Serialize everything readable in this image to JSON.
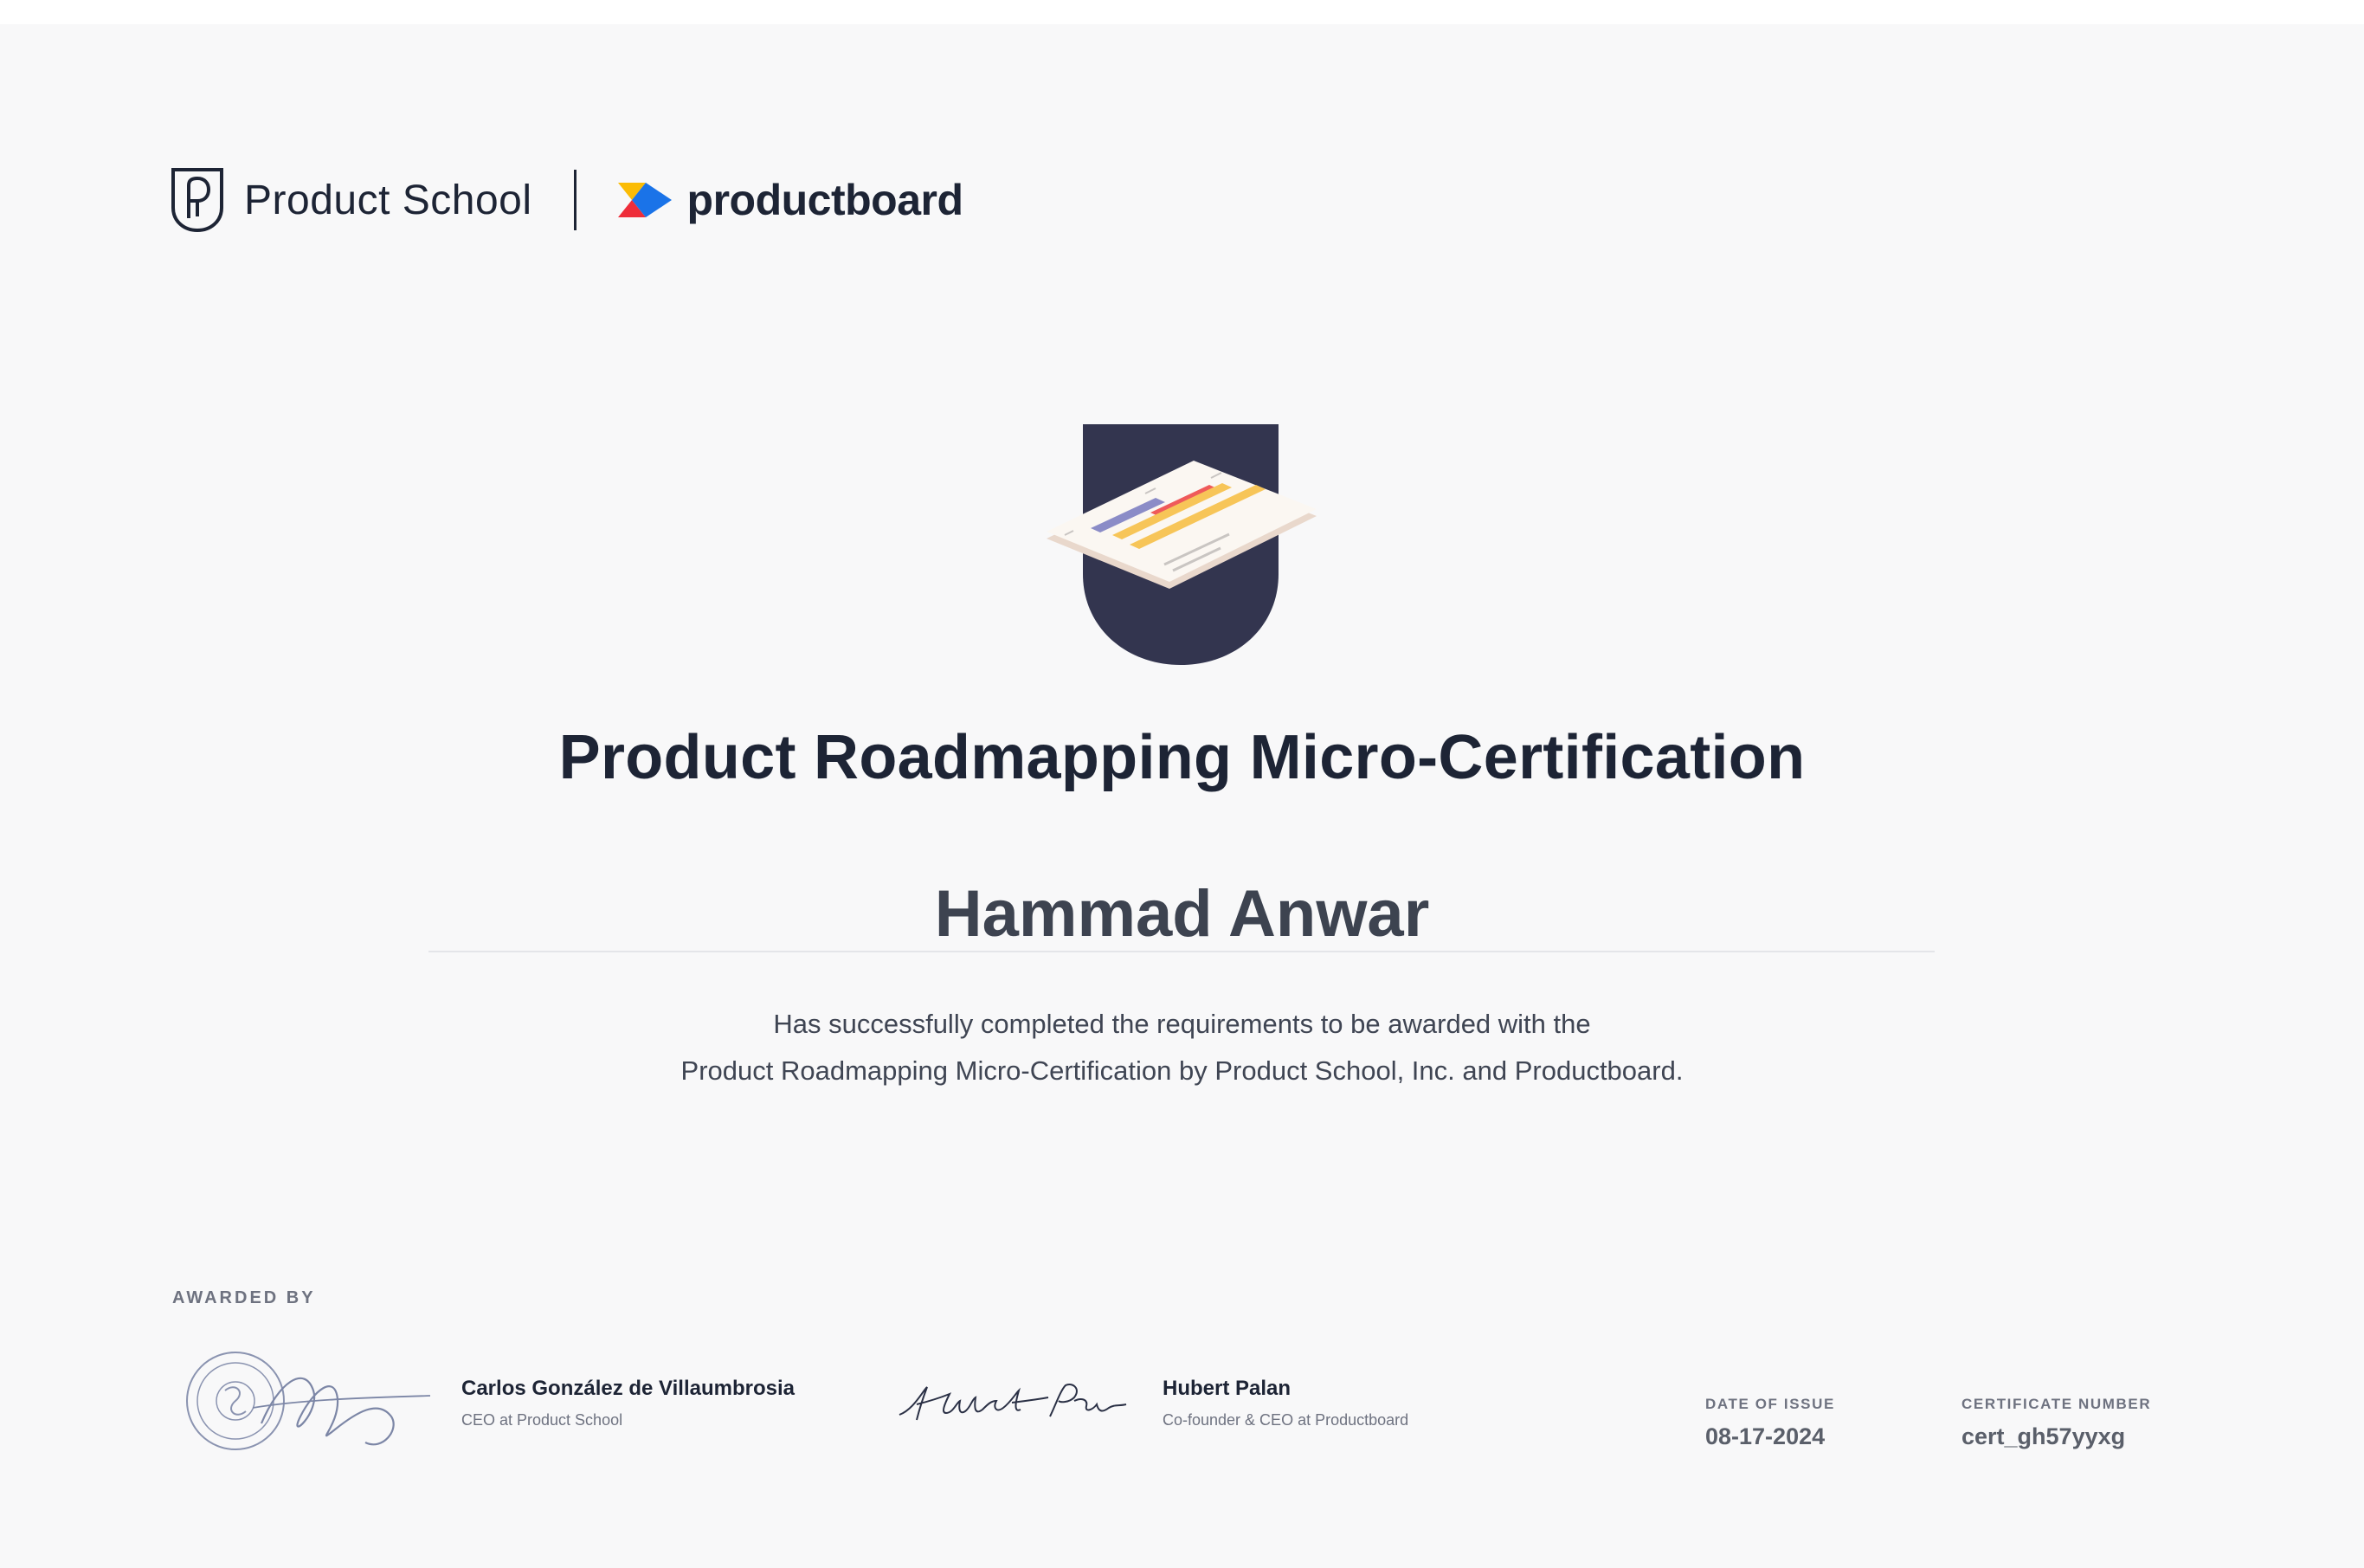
{
  "header": {
    "brand_primary": "Product School",
    "brand_secondary": "productboard"
  },
  "certificate": {
    "title": "Product Roadmapping Micro-Certification",
    "recipient": "Hammad Anwar",
    "statement_line1": "Has successfully completed the requirements to be awarded with the",
    "statement_line2": "Product Roadmapping Micro-Certification by Product School, Inc. and Productboard."
  },
  "awarded_by": {
    "label": "AWARDED BY",
    "signers": [
      {
        "name": "Carlos González de Villaumbrosia",
        "role": "CEO at Product School"
      },
      {
        "name": "Hubert Palan",
        "role": "Co-founder & CEO at Productboard"
      }
    ]
  },
  "meta": {
    "date_label": "DATE OF ISSUE",
    "date_value": "08-17-2024",
    "cert_label": "CERTIFICATE NUMBER",
    "cert_value": "cert_gh57yyxg"
  },
  "colors": {
    "navy": "#1d2435",
    "badge_navy": "#33354f",
    "accent_red": "#ef5a5a",
    "accent_yellow": "#f7c558",
    "accent_purple": "#8b8cc7",
    "pb_blue": "#1a73e8",
    "pb_red": "#ee2d3a",
    "pb_yellow": "#fbbc05"
  },
  "icons": {
    "product_school_logo": "shield-p-icon",
    "productboard_logo": "productboard-mark-icon",
    "badge": "roadmap-badge-icon",
    "seal": "seal-icon",
    "signature": "signature-icon"
  }
}
